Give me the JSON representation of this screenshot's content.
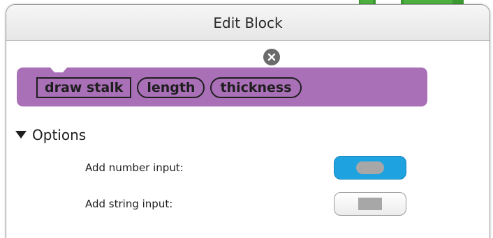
{
  "dialog": {
    "title": "Edit Block"
  },
  "block": {
    "name": "draw stalk",
    "params": [
      "length",
      "thickness"
    ],
    "color": "#a970b7"
  },
  "options": {
    "header": "Options",
    "rows": [
      {
        "label": "Add number input:",
        "shape": "rounded-pill",
        "active": true,
        "color": "#1ea3e0"
      },
      {
        "label": "Add string input:",
        "shape": "rectangle",
        "active": false
      }
    ]
  },
  "icons": {
    "close": "close-circle-icon",
    "expand": "triangle-down-icon"
  }
}
